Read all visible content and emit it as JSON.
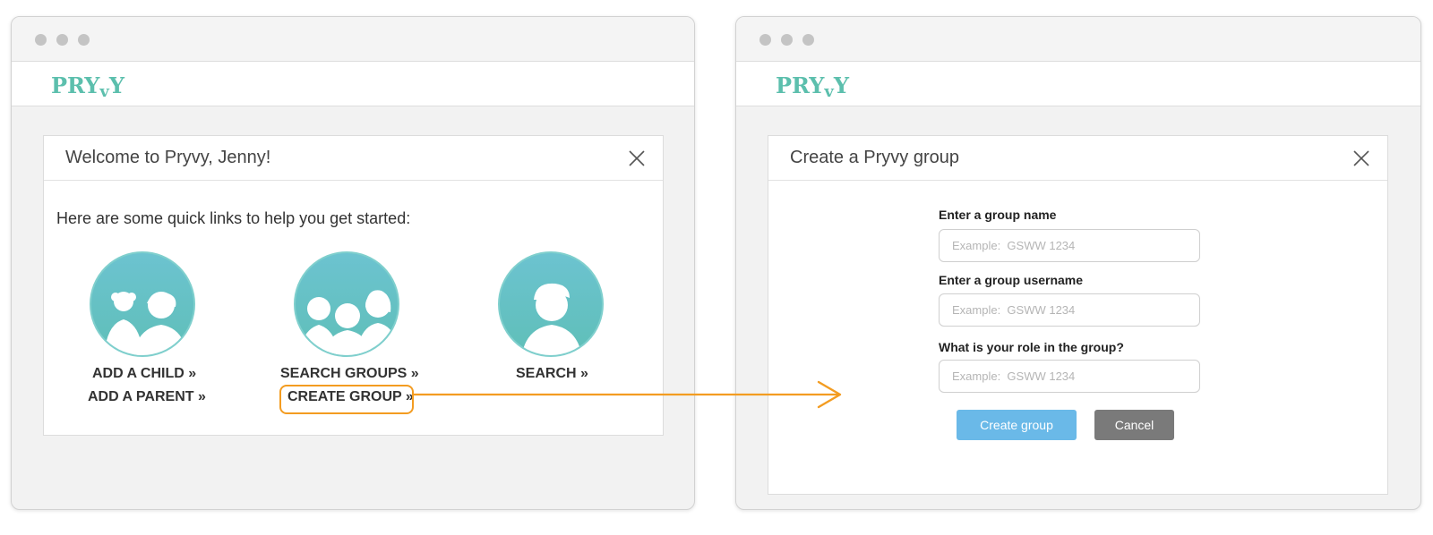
{
  "brand": {
    "logo_prefix": "PRY",
    "logo_v": "v",
    "logo_suffix": "Y",
    "color": "#5cbfad"
  },
  "welcome_dialog": {
    "title": "Welcome to Pryvy, Jenny!",
    "intro": "Here are some quick links to help you get started:",
    "links": {
      "add_child": "ADD A CHILD »",
      "add_parent": "ADD A PARENT »",
      "search_groups": "SEARCH GROUPS »",
      "create_group": "CREATE GROUP »",
      "search": "SEARCH »"
    },
    "icons": [
      "children-icon",
      "group-icon",
      "person-icon"
    ]
  },
  "create_dialog": {
    "title": "Create a Pryvy group",
    "fields": [
      {
        "label": "Enter a group name",
        "placeholder": "Example:  GSWW 1234"
      },
      {
        "label": "Enter a group username",
        "placeholder": "Example:  GSWW 1234"
      },
      {
        "label": "What is your role in the group?",
        "placeholder": "Example:  GSWW 1234"
      }
    ],
    "create_label": "Create group",
    "cancel_label": "Cancel"
  },
  "colors": {
    "highlight": "#f39c21",
    "create_button": "#6ab9e8",
    "cancel_button": "#7a7a7a",
    "icon_circle": "#64c1c6"
  }
}
